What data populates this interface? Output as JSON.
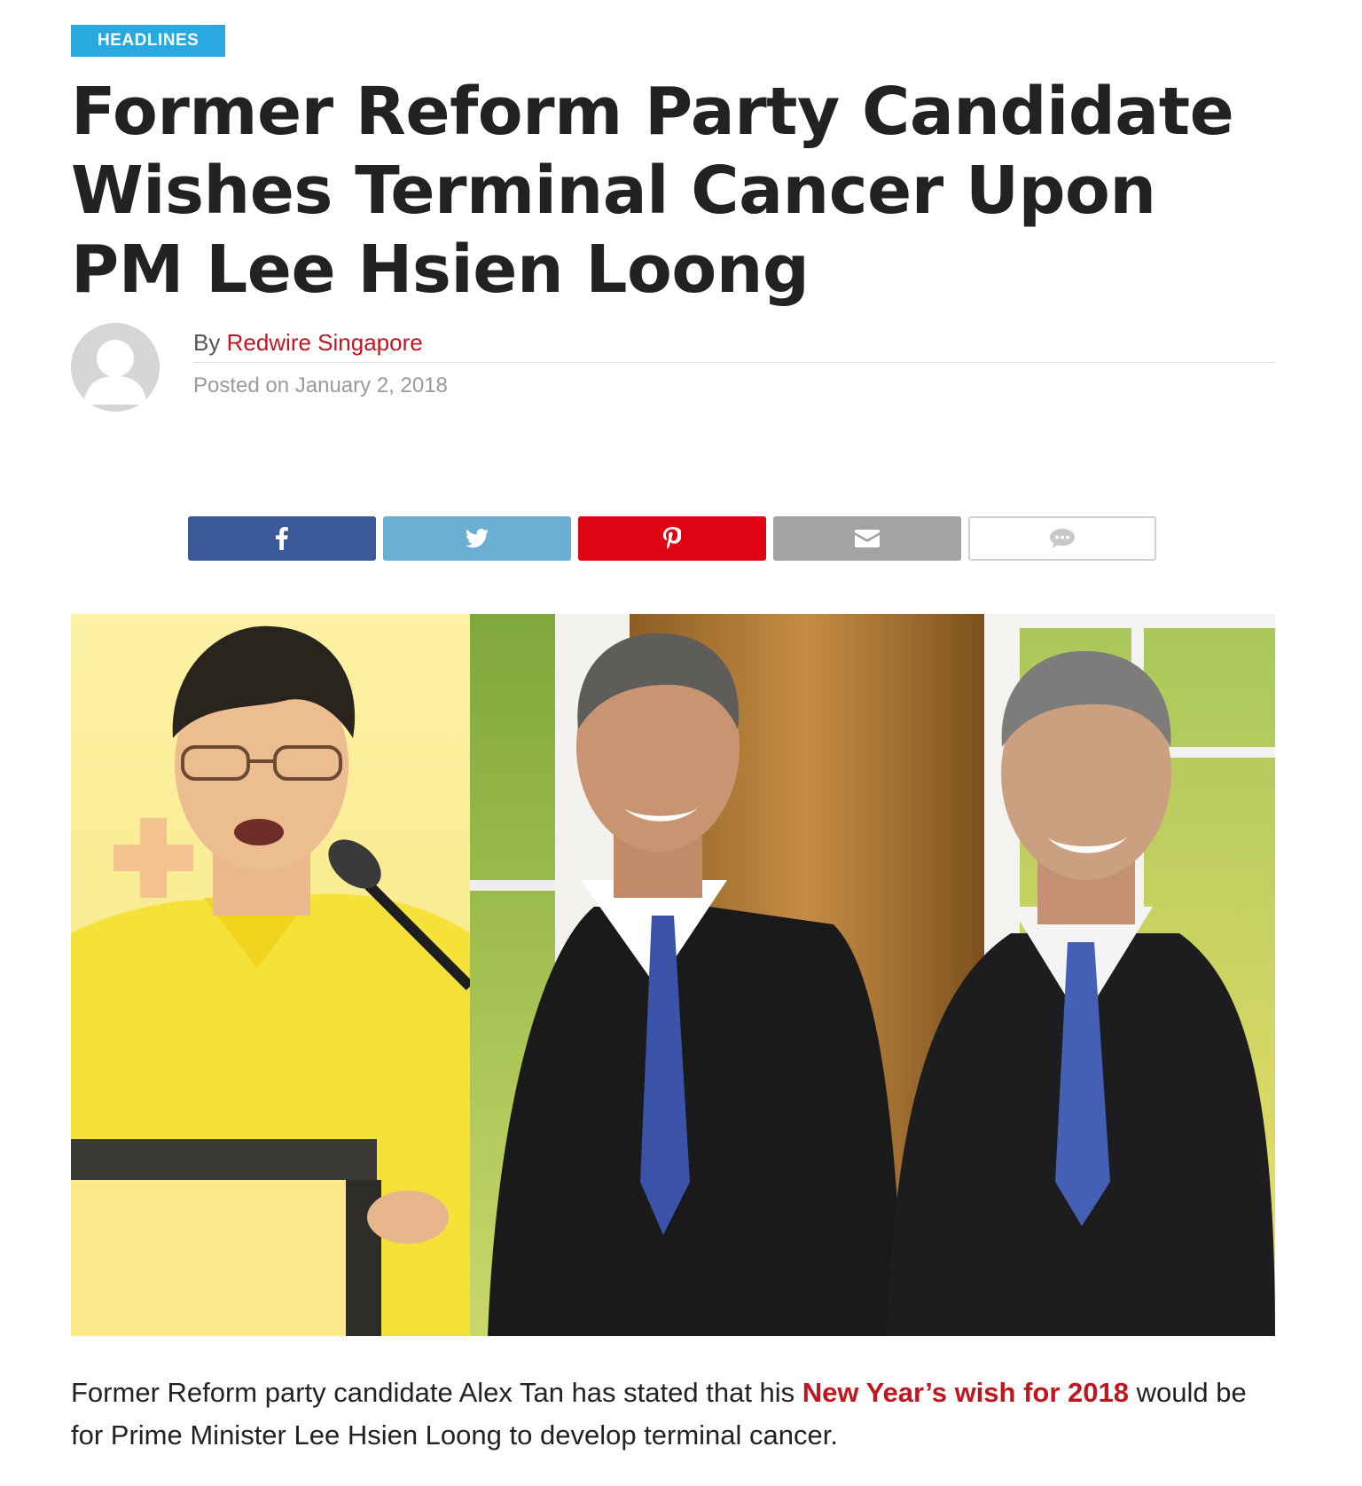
{
  "article": {
    "category": "HEADLINES",
    "title": "Former Reform Party Candidate Wishes Terminal Cancer Upon PM Lee Hsien Loong",
    "byline_prefix": "By",
    "author": "Redwire Singapore",
    "posted_prefix": "Posted on",
    "date": "January 2, 2018",
    "body": {
      "text_before": "Former Reform party candidate Alex Tan has stated that his ",
      "highlight": "New Year’s wish for 2018",
      "text_after": " would be for Prime Minister Lee Hsien Loong to develop terminal cancer."
    }
  },
  "share": {
    "buttons": [
      {
        "network": "facebook",
        "icon": "facebook-icon",
        "color": "#3b5998"
      },
      {
        "network": "twitter",
        "icon": "twitter-icon",
        "color": "#6aaed3"
      },
      {
        "network": "pinterest",
        "icon": "pinterest-icon",
        "color": "#e00512"
      },
      {
        "network": "email",
        "icon": "email-icon",
        "color": "#a3a3a3"
      },
      {
        "network": "comments",
        "icon": "comment-icon",
        "color": "#ffffff"
      }
    ]
  },
  "colors": {
    "category_bg": "#2aa8e0",
    "accent_red": "#c0161f",
    "headline": "#222222"
  }
}
